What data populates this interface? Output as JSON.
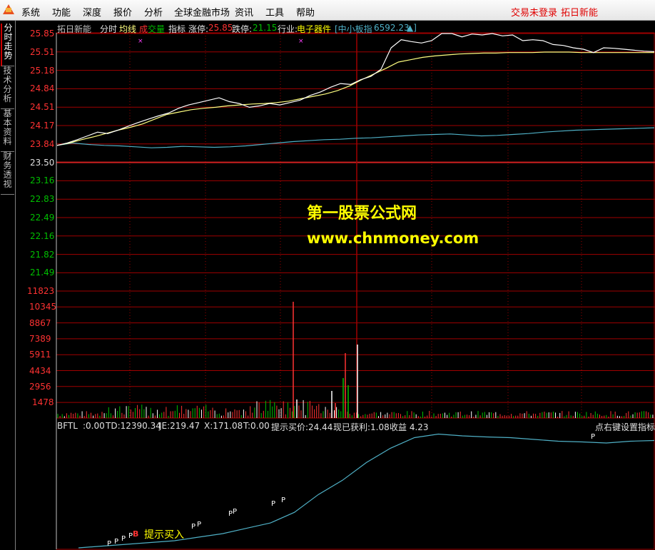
{
  "menu": {
    "items": [
      "系统",
      "功能",
      "深度",
      "报价",
      "分析",
      "全球金融市场",
      "资讯",
      "工具",
      "帮助"
    ],
    "login_status": "交易未登录",
    "stock_name_right": "拓日新能"
  },
  "sidebar": {
    "tabs": [
      "分时走势",
      "技术分析",
      "基本资料",
      "财务透视"
    ],
    "active_index": 0
  },
  "header": {
    "stock_name": "拓日新能",
    "mode": "分时",
    "avg_line": "均线",
    "volume_a": "成",
    "volume_b": "交量",
    "indicator": "指标",
    "limit_up_label": "涨停:",
    "limit_up_value": "25.85",
    "limit_down_label": "跌停:",
    "limit_down_value": "21.15",
    "industry_label": "行业:",
    "industry_value": "电子器件",
    "index_label": "[中小板指",
    "index_value": "6592.23",
    "index_arrow": "▲]"
  },
  "price_axis": {
    "labels": [
      "25.85",
      "25.51",
      "25.18",
      "24.84",
      "24.51",
      "24.17",
      "23.84",
      "23.50",
      "23.16",
      "22.83",
      "22.49",
      "22.16",
      "21.82",
      "21.49"
    ],
    "prev_close": "23.50"
  },
  "volume_axis": {
    "labels": [
      "11823",
      "10345",
      "8867",
      "7389",
      "5911",
      "4434",
      "2956",
      "1478"
    ]
  },
  "indicator_bar": {
    "name": "BFTL",
    "v0": ":0.00",
    "td": "TD:12390.34",
    "je": "JE:219.47",
    "x": "X:171.08",
    "t": "T:0.00",
    "hint_buy": "提示买价:24.44",
    "profit": "现已获利:1.08",
    "income": "收益 4.23",
    "right_hint": "点右键设置指标"
  },
  "signals": {
    "buy_text": "提示买入",
    "marker_p": "P",
    "marker_b": "B"
  },
  "watermark": {
    "title": "第一股票公式网",
    "url": "www.chnmoney.com"
  },
  "colors": {
    "price_line": "#ffffff",
    "avg_line": "#ffff80",
    "index_line": "#4fb0c6",
    "grid": "#a00000",
    "up_color": "#ff3232",
    "down_color": "#00c000",
    "vol_up": "#ff3232",
    "vol_down": "#00c000",
    "vol_flat": "#ffffff"
  },
  "chart_data": {
    "type": "line",
    "title": "拓日新能 分时",
    "y_range": [
      21.15,
      25.85
    ],
    "prev_close": 23.5,
    "series": [
      {
        "name": "分时",
        "values": [
          23.5,
          23.55,
          23.62,
          23.7,
          23.78,
          23.75,
          23.82,
          23.9,
          23.98,
          24.05,
          24.12,
          24.18,
          24.28,
          24.35,
          24.4,
          24.45,
          24.5,
          24.42,
          24.38,
          24.3,
          24.33,
          24.38,
          24.35,
          24.4,
          24.45,
          24.55,
          24.62,
          24.72,
          24.8,
          24.78,
          24.88,
          24.95,
          25.1,
          25.55,
          25.72,
          25.68,
          25.65,
          25.7,
          25.85,
          25.85,
          25.78,
          25.84,
          25.82,
          25.85,
          25.8,
          25.82,
          25.7,
          25.72,
          25.7,
          25.62,
          25.6,
          25.55,
          25.52,
          25.45,
          25.55,
          25.54,
          25.52,
          25.5,
          25.48,
          25.47
        ]
      },
      {
        "name": "均线",
        "values": [
          23.5,
          23.55,
          23.62,
          23.68,
          23.75,
          23.82,
          23.88,
          23.95,
          24.05,
          24.15,
          24.2,
          24.25,
          24.28,
          24.3,
          24.33,
          24.35,
          24.37,
          24.38,
          24.4,
          24.43,
          24.48,
          24.53,
          24.58,
          24.65,
          24.75,
          24.88,
          25.0,
          25.12,
          25.25,
          25.3,
          25.35,
          25.38,
          25.4,
          25.42,
          25.43,
          25.44,
          25.44,
          25.45,
          25.45,
          25.45,
          25.46,
          25.46,
          25.46,
          25.45,
          25.45,
          25.45,
          25.45,
          25.45,
          25.45,
          25.45
        ]
      },
      {
        "name": "中小板指",
        "values": [
          23.5,
          23.55,
          23.52,
          23.5,
          23.49,
          23.47,
          23.45,
          23.46,
          23.48,
          23.47,
          23.46,
          23.47,
          23.49,
          23.52,
          23.55,
          23.58,
          23.6,
          23.62,
          23.63,
          23.65,
          23.66,
          23.68,
          23.7,
          23.72,
          23.73,
          23.74,
          23.72,
          23.7,
          23.71,
          23.73,
          23.75,
          23.78,
          23.8,
          23.82,
          23.83,
          23.84,
          23.85,
          23.86,
          23.87
        ]
      }
    ],
    "volume": {
      "max": 11823,
      "big_bars": [
        11000,
        6000,
        7000,
        3800,
        3100,
        2400,
        2200,
        1800
      ]
    },
    "indicator_bftl": {
      "values": [
        0.0,
        0.05,
        0.1,
        0.15,
        0.2,
        0.3,
        0.4,
        0.55,
        0.7,
        1.0,
        1.5,
        1.9,
        2.4,
        2.8,
        3.1,
        3.2,
        3.15,
        3.12,
        3.1,
        3.05,
        3.0,
        2.98,
        2.95,
        3.0,
        3.02
      ]
    }
  }
}
